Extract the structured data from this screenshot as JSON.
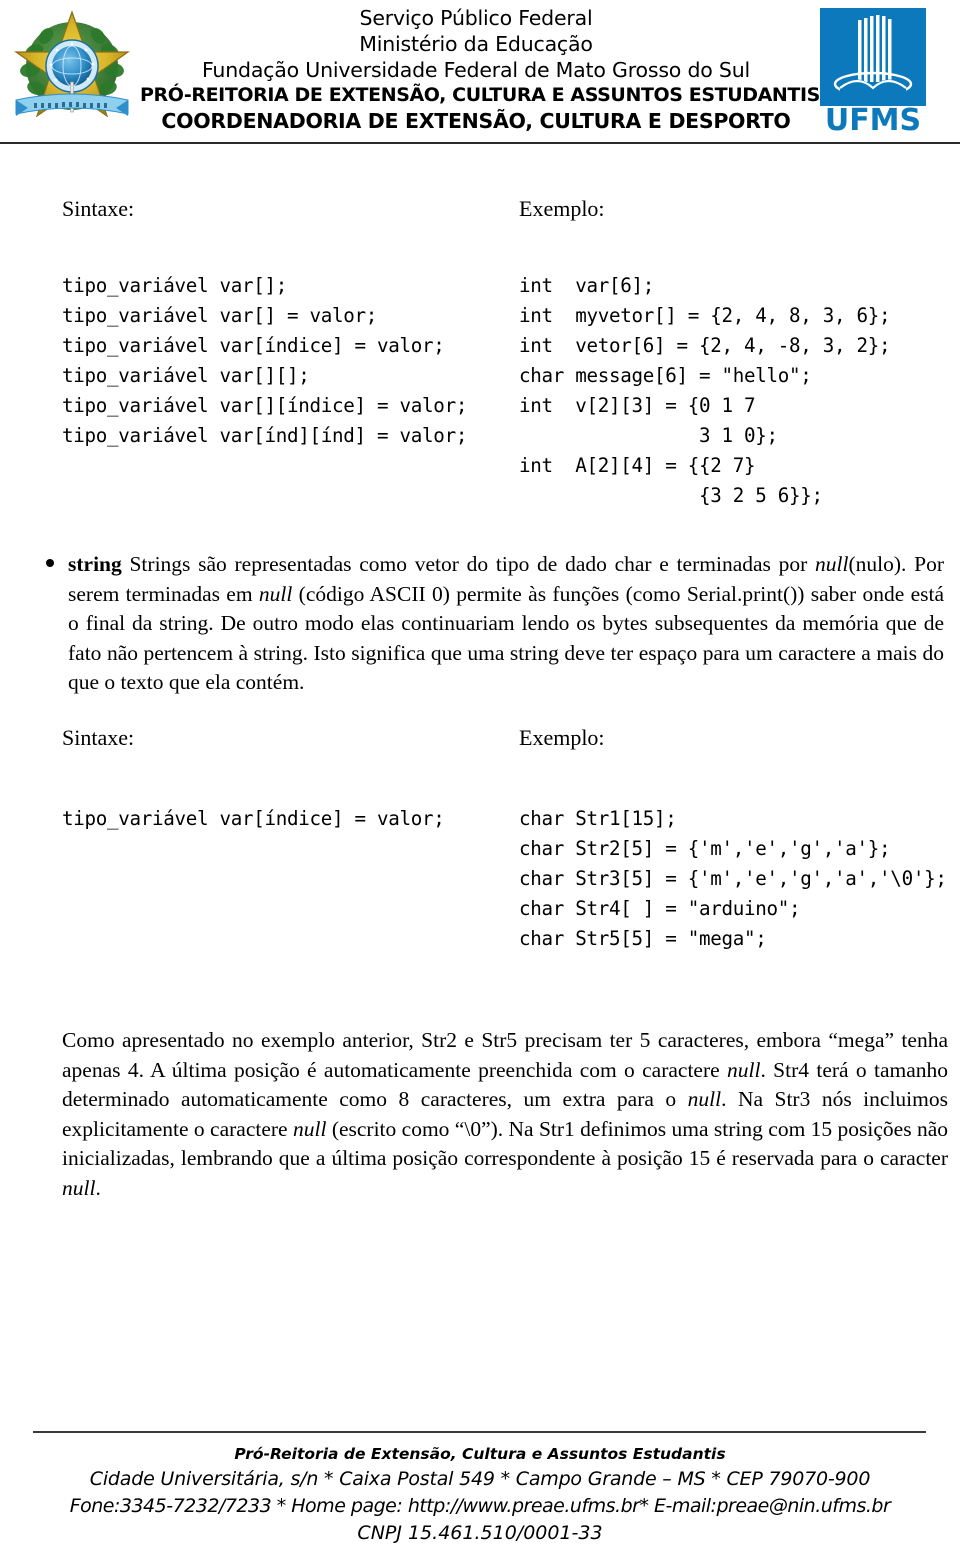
{
  "header": {
    "emblem_left": "brazil-coat-of-arms",
    "emblem_right": "ufms-logo",
    "logo_text": "UFMS",
    "line1": "Serviço Público Federal",
    "line2": "Ministério da Educação",
    "line3": "Fundação Universidade Federal de Mato Grosso do Sul",
    "line4": "PRÓ-REITORIA DE EXTENSÃO, CULTURA E ASSUNTOS ESTUDANTIS",
    "line5": "COORDENADORIA DE EXTENSÃO, CULTURA E DESPORTO"
  },
  "colors": {
    "ufms_blue": "#0d79bd",
    "rule": "#2b2b2b",
    "text": "#000000"
  },
  "section_arrays": {
    "label_sintaxe": "Sintaxe:",
    "label_exemplo": "Exemplo:",
    "syntax_code": "tipo_variável var[];\ntipo_variável var[] = valor;\ntipo_variável var[índice] = valor;\ntipo_variável var[][];\ntipo_variável var[][índice] = valor;\ntipo_variável var[índ][índ] = valor;",
    "example_code": "int  var[6];\nint  myvetor[] = {2, 4, 8, 3, 6};\nint  vetor[6] = {2, 4, -8, 3, 2};\nchar message[6] = \"hello\";\nint  v[2][3] = {0 1 7\n                3 1 0};\nint  A[2][4] = {{2 7}\n                {3 2 5 6}};"
  },
  "string_bullet": {
    "term": "string",
    "text_1": " Strings são representadas como vetor do tipo de dado char e terminadas por ",
    "em_1": "null",
    "text_2": "(nulo). Por serem terminadas em ",
    "em_2": "null",
    "text_3": " (código ASCII 0) permite às funções (como Serial.print()) saber onde está o final da string. De outro modo elas continuariam lendo os bytes subsequentes da memória que de fato não pertencem à string. Isto significa que uma string deve ter espaço para um caractere a mais do que o texto que ela contém."
  },
  "section_strings": {
    "label_sintaxe": "Sintaxe:",
    "label_exemplo": "Exemplo:",
    "syntax_code": "tipo_variável var[índice] = valor;",
    "example_code": "char Str1[15];\nchar Str2[5] = {'m','e','g','a'};\nchar Str3[5] = {'m','e','g','a','\\0'};\nchar Str4[ ] = \"arduino\";\nchar Str5[5] = \"mega\";"
  },
  "final_paragraph": {
    "text_1": "Como apresentado no exemplo anterior, Str2 e Str5 precisam ter 5 caracteres, embora “mega” tenha apenas 4. A última posição é automaticamente preenchida com o caractere ",
    "em_1": "null",
    "text_2": ". Str4 terá o tamanho determinado automaticamente como 8 caracteres, um extra para o ",
    "em_2": "null",
    "text_3": ". Na Str3 nós incluimos explicitamente o caractere ",
    "em_3": "null",
    "text_4": " (escrito como “\\0”). Na Str1 definimos uma string com 15 posições não inicializadas, lembrando que a última posição correspondente à posição 15 é reservada para o caracter ",
    "em_4": "null",
    "text_5": "."
  },
  "footer": {
    "line1": "Pró-Reitoria de Extensão, Cultura e Assuntos Estudantis",
    "line2": "Cidade Universitária, s/n * Caixa Postal 549 * Campo Grande – MS * CEP 79070-900",
    "line3": "Fone:3345-7232/7233 * Home page: http://www.preae.ufms.br* E-mail:preae@nin.ufms.br",
    "line4": "CNPJ 15.461.510/0001-33"
  }
}
